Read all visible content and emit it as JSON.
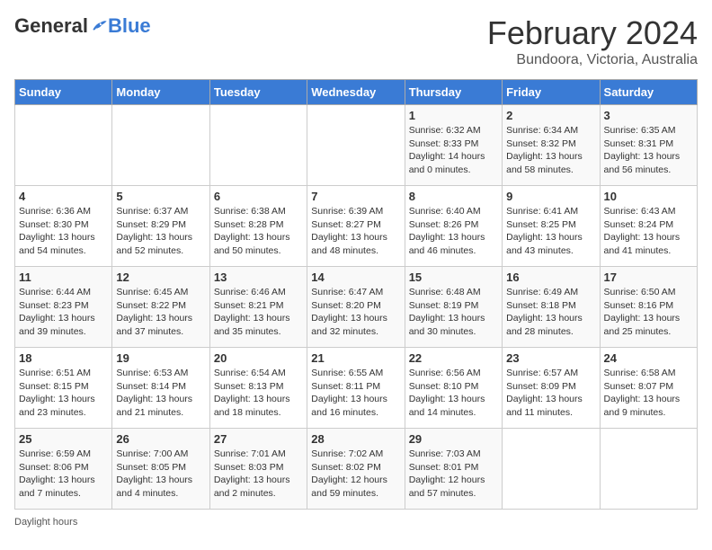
{
  "header": {
    "logo_general": "General",
    "logo_blue": "Blue",
    "month": "February 2024",
    "location": "Bundoora, Victoria, Australia"
  },
  "days_of_week": [
    "Sunday",
    "Monday",
    "Tuesday",
    "Wednesday",
    "Thursday",
    "Friday",
    "Saturday"
  ],
  "weeks": [
    [
      {
        "num": "",
        "info": ""
      },
      {
        "num": "",
        "info": ""
      },
      {
        "num": "",
        "info": ""
      },
      {
        "num": "",
        "info": ""
      },
      {
        "num": "1",
        "info": "Sunrise: 6:32 AM\nSunset: 8:33 PM\nDaylight: 14 hours\nand 0 minutes."
      },
      {
        "num": "2",
        "info": "Sunrise: 6:34 AM\nSunset: 8:32 PM\nDaylight: 13 hours\nand 58 minutes."
      },
      {
        "num": "3",
        "info": "Sunrise: 6:35 AM\nSunset: 8:31 PM\nDaylight: 13 hours\nand 56 minutes."
      }
    ],
    [
      {
        "num": "4",
        "info": "Sunrise: 6:36 AM\nSunset: 8:30 PM\nDaylight: 13 hours\nand 54 minutes."
      },
      {
        "num": "5",
        "info": "Sunrise: 6:37 AM\nSunset: 8:29 PM\nDaylight: 13 hours\nand 52 minutes."
      },
      {
        "num": "6",
        "info": "Sunrise: 6:38 AM\nSunset: 8:28 PM\nDaylight: 13 hours\nand 50 minutes."
      },
      {
        "num": "7",
        "info": "Sunrise: 6:39 AM\nSunset: 8:27 PM\nDaylight: 13 hours\nand 48 minutes."
      },
      {
        "num": "8",
        "info": "Sunrise: 6:40 AM\nSunset: 8:26 PM\nDaylight: 13 hours\nand 46 minutes."
      },
      {
        "num": "9",
        "info": "Sunrise: 6:41 AM\nSunset: 8:25 PM\nDaylight: 13 hours\nand 43 minutes."
      },
      {
        "num": "10",
        "info": "Sunrise: 6:43 AM\nSunset: 8:24 PM\nDaylight: 13 hours\nand 41 minutes."
      }
    ],
    [
      {
        "num": "11",
        "info": "Sunrise: 6:44 AM\nSunset: 8:23 PM\nDaylight: 13 hours\nand 39 minutes."
      },
      {
        "num": "12",
        "info": "Sunrise: 6:45 AM\nSunset: 8:22 PM\nDaylight: 13 hours\nand 37 minutes."
      },
      {
        "num": "13",
        "info": "Sunrise: 6:46 AM\nSunset: 8:21 PM\nDaylight: 13 hours\nand 35 minutes."
      },
      {
        "num": "14",
        "info": "Sunrise: 6:47 AM\nSunset: 8:20 PM\nDaylight: 13 hours\nand 32 minutes."
      },
      {
        "num": "15",
        "info": "Sunrise: 6:48 AM\nSunset: 8:19 PM\nDaylight: 13 hours\nand 30 minutes."
      },
      {
        "num": "16",
        "info": "Sunrise: 6:49 AM\nSunset: 8:18 PM\nDaylight: 13 hours\nand 28 minutes."
      },
      {
        "num": "17",
        "info": "Sunrise: 6:50 AM\nSunset: 8:16 PM\nDaylight: 13 hours\nand 25 minutes."
      }
    ],
    [
      {
        "num": "18",
        "info": "Sunrise: 6:51 AM\nSunset: 8:15 PM\nDaylight: 13 hours\nand 23 minutes."
      },
      {
        "num": "19",
        "info": "Sunrise: 6:53 AM\nSunset: 8:14 PM\nDaylight: 13 hours\nand 21 minutes."
      },
      {
        "num": "20",
        "info": "Sunrise: 6:54 AM\nSunset: 8:13 PM\nDaylight: 13 hours\nand 18 minutes."
      },
      {
        "num": "21",
        "info": "Sunrise: 6:55 AM\nSunset: 8:11 PM\nDaylight: 13 hours\nand 16 minutes."
      },
      {
        "num": "22",
        "info": "Sunrise: 6:56 AM\nSunset: 8:10 PM\nDaylight: 13 hours\nand 14 minutes."
      },
      {
        "num": "23",
        "info": "Sunrise: 6:57 AM\nSunset: 8:09 PM\nDaylight: 13 hours\nand 11 minutes."
      },
      {
        "num": "24",
        "info": "Sunrise: 6:58 AM\nSunset: 8:07 PM\nDaylight: 13 hours\nand 9 minutes."
      }
    ],
    [
      {
        "num": "25",
        "info": "Sunrise: 6:59 AM\nSunset: 8:06 PM\nDaylight: 13 hours\nand 7 minutes."
      },
      {
        "num": "26",
        "info": "Sunrise: 7:00 AM\nSunset: 8:05 PM\nDaylight: 13 hours\nand 4 minutes."
      },
      {
        "num": "27",
        "info": "Sunrise: 7:01 AM\nSunset: 8:03 PM\nDaylight: 13 hours\nand 2 minutes."
      },
      {
        "num": "28",
        "info": "Sunrise: 7:02 AM\nSunset: 8:02 PM\nDaylight: 12 hours\nand 59 minutes."
      },
      {
        "num": "29",
        "info": "Sunrise: 7:03 AM\nSunset: 8:01 PM\nDaylight: 12 hours\nand 57 minutes."
      },
      {
        "num": "",
        "info": ""
      },
      {
        "num": "",
        "info": ""
      }
    ]
  ],
  "footer": {
    "note": "Daylight hours"
  }
}
